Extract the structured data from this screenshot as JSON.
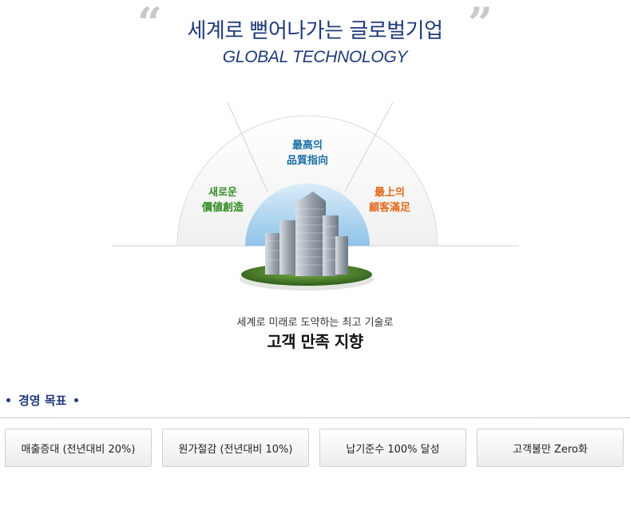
{
  "header": {
    "headline": "세계로 뻗어나가는 글로벌기업",
    "subheadline": "GLOBAL TECHNOLOGY",
    "quote_open": "“",
    "quote_close": "”"
  },
  "diagram": {
    "values": [
      {
        "line1": "새로운",
        "line2": "價値創造",
        "color": "#2e8b1f"
      },
      {
        "line1": "最高의",
        "line2": "品質指向",
        "color": "#1a6fa8"
      },
      {
        "line1": "最上의",
        "line2": "顧客滿足",
        "color": "#e26a1b"
      }
    ],
    "center_image": "building-illustration"
  },
  "tagline": "세계로 미래로 도약하는 최고 기술로",
  "slogan": "고객 만족 지향",
  "goals": {
    "title": "경영 목표",
    "items": [
      "매출증대 (전년대비 20%)",
      "원가절감 (전년대비 10%)",
      "납기준수 100% 달성",
      "고객불만 Zero화"
    ]
  }
}
